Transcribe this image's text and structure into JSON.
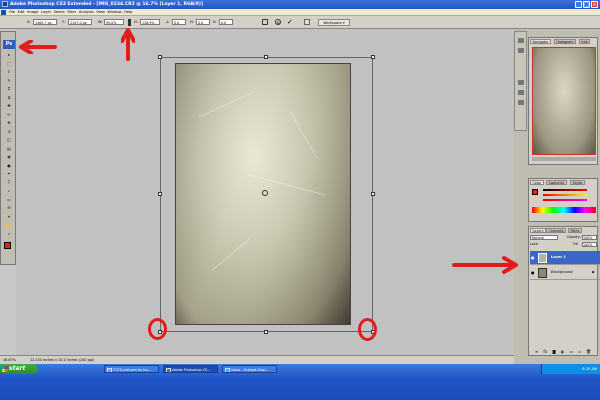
{
  "window": {
    "title": "Adobe Photoshop CS3 Extended - [IMG_0234.CR2 @ 16.7% (Layer 1, RGB/8)]",
    "min": "_",
    "max": "□",
    "close": "×"
  },
  "menu": [
    "File",
    "Edit",
    "Image",
    "Layer",
    "Select",
    "Filter",
    "Analysis",
    "View",
    "Window",
    "Help"
  ],
  "options": {
    "x_label": "X:",
    "x_value": "1463.7 px",
    "y_label": "Y:",
    "y_value": "2107.0 px",
    "w_label": "W:",
    "w_value": "95.0%",
    "h_label": "H:",
    "h_value": "126.9%",
    "angle_value": "0.0",
    "h_skew_label": "H:",
    "h_skew": "0.0",
    "v_skew_label": "V:",
    "v_skew": "0.0",
    "workspace": "Workspace ▾"
  },
  "toolbox": {
    "logo": "Ps"
  },
  "status": {
    "zoom": "16.67%",
    "doc_info": "12.133 inches x 10.2 inches (240 ppi)"
  },
  "panels": {
    "navigator_tabs": [
      "Navigator",
      "Histogram",
      "Info"
    ],
    "color_tabs": [
      "Color",
      "Swatches",
      "Styles"
    ],
    "layers_tabs": [
      "Layers",
      "Channels",
      "Paths"
    ],
    "blend_mode": "Normal",
    "opacity_label": "Opacity:",
    "opacity": "100%",
    "lock_label": "Lock:",
    "fill_label": "Fill:",
    "fill": "100%",
    "layers": [
      {
        "name": "Layer 1",
        "selected": true
      },
      {
        "name": "Background",
        "selected": false
      }
    ]
  },
  "taskbar": {
    "start": "start",
    "tasks": [
      {
        "label": "FOTO pictures by ins..."
      },
      {
        "label": "Adobe Photoshop CS..."
      },
      {
        "label": "Inbox - Outlook Expr..."
      }
    ],
    "clock": "8:20 AM"
  },
  "colors": {
    "annotation": "#e41b1b",
    "selected_layer": "#3a66c8"
  }
}
